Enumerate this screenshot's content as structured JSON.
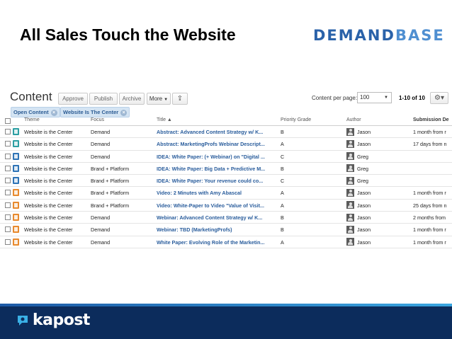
{
  "slide": {
    "title": "All Sales Touch the Website",
    "brand_main": "DEMAND",
    "brand_light": "BASE"
  },
  "app": {
    "heading": "Content",
    "buttons": {
      "approve": "Approve",
      "publish": "Publish",
      "archive": "Archive",
      "more": "More",
      "more_caret": "▼",
      "export": "⇪"
    },
    "per_page_label": "Content per page:",
    "per_page_value": "100",
    "per_page_caret": "▼",
    "paging": "1-10 of 10",
    "settings": "⚙▾",
    "filters": [
      {
        "label": "Open Content",
        "remove": "×"
      },
      {
        "label": "Website Is The Center",
        "remove": "×"
      }
    ],
    "columns": {
      "theme": "Theme",
      "focus": "Focus",
      "title": "Title ▲",
      "priority": "Priority Grade",
      "author": "Author",
      "due": "Submission De"
    },
    "rows": [
      {
        "icon": "teal",
        "theme": "Website is the Center",
        "focus": "Demand",
        "title": "Abstract: Advanced Content Strategy w/ K...",
        "grade": "B",
        "author": "Jason",
        "due": "1 month from r"
      },
      {
        "icon": "teal",
        "theme": "Website is the Center",
        "focus": "Demand",
        "title": "Abstract: MarketingProfs Webinar Descript...",
        "grade": "A",
        "author": "Jason",
        "due": "17 days from n"
      },
      {
        "icon": "blue",
        "theme": "Website is the Center",
        "focus": "Demand",
        "title": "IDEA: White Paper: (+ Webinar) on \"Digital ...",
        "grade": "C",
        "author": "Greg",
        "due": ""
      },
      {
        "icon": "blue",
        "theme": "Website is the Center",
        "focus": "Brand + Platform",
        "title": "IDEA: White Paper: Big Data + Predictive M...",
        "grade": "B",
        "author": "Greg",
        "due": ""
      },
      {
        "icon": "blue",
        "theme": "Website is the Center",
        "focus": "Brand + Platform",
        "title": "IDEA: White Paper: Your revenue could co...",
        "grade": "C",
        "author": "Greg",
        "due": ""
      },
      {
        "icon": "orange",
        "theme": "Website is the Center",
        "focus": "Brand + Platform",
        "title": "Video: 2 Minutes with Amy Abascal",
        "grade": "A",
        "author": "Jason",
        "due": "1 month from r"
      },
      {
        "icon": "orange",
        "theme": "Website is the Center",
        "focus": "Brand + Platform",
        "title": "Video: White-Paper to Video \"Value of Visit...",
        "grade": "A",
        "author": "Jason",
        "due": "25 days from n"
      },
      {
        "icon": "orange",
        "theme": "Website is the Center",
        "focus": "Demand",
        "title": "Webinar: Advanced Content Strategy w/ K...",
        "grade": "B",
        "author": "Jason",
        "due": "2 months from"
      },
      {
        "icon": "orange",
        "theme": "Website is the Center",
        "focus": "Demand",
        "title": "Webinar: TBD (MarketingProfs)",
        "grade": "B",
        "author": "Jason",
        "due": "1 month from r"
      },
      {
        "icon": "orange",
        "theme": "Website is the Center",
        "focus": "Demand",
        "title": "White Paper: Evolving Role of the Marketin...",
        "grade": "A",
        "author": "Jason",
        "due": "1 month from r"
      }
    ]
  },
  "footer": {
    "logo_text": "kapost"
  },
  "colors": {
    "teal": "#2d9fa3",
    "blue": "#2f74b6",
    "orange": "#e88a2e",
    "footer_bg": "#0c2c5c",
    "link": "#2a5d9c"
  }
}
